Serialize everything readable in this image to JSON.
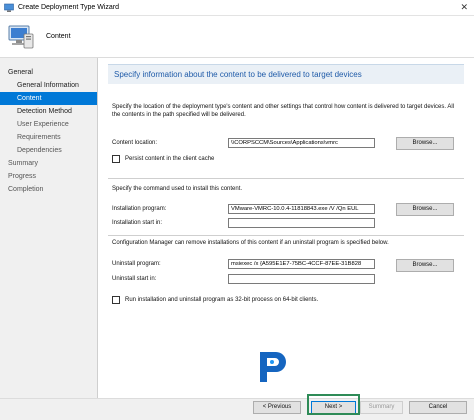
{
  "window": {
    "title": "Create Deployment Type Wizard",
    "close_glyph": "✕"
  },
  "header": {
    "page_heading": "Content"
  },
  "nav": {
    "items": [
      {
        "label": "General",
        "level": 0,
        "state": "dark"
      },
      {
        "label": "General Information",
        "level": 1,
        "state": "dark"
      },
      {
        "label": "Content",
        "level": 1,
        "state": "active"
      },
      {
        "label": "Detection Method",
        "level": 1,
        "state": "dark"
      },
      {
        "label": "User Experience",
        "level": 1,
        "state": "normal"
      },
      {
        "label": "Requirements",
        "level": 1,
        "state": "normal"
      },
      {
        "label": "Dependencies",
        "level": 1,
        "state": "normal"
      },
      {
        "label": "Summary",
        "level": 0,
        "state": "normal"
      },
      {
        "label": "Progress",
        "level": 0,
        "state": "normal"
      },
      {
        "label": "Completion",
        "level": 0,
        "state": "normal"
      }
    ]
  },
  "main": {
    "heading": "Specify information about the content to be delivered to target devices",
    "description": "Specify the location of the deployment type's content and other settings that control how content is delivered to target devices. All the contents in the path specified will be delivered.",
    "content_location": {
      "label": "Content location:",
      "value": "\\\\CORPSCCM\\Sources\\Applications\\vmrc",
      "browse": "Browse..."
    },
    "persist_cache": {
      "label": "Persist content in the client cache",
      "checked": false
    },
    "install_intro": "Specify the command used to install this content.",
    "installation_program": {
      "label": "Installation program:",
      "value": "VMware-VMRC-10.0.4-11818843.exe /V /Qn EUL",
      "browse": "Browse..."
    },
    "installation_start_in": {
      "label": "Installation start in:",
      "value": ""
    },
    "uninstall_intro": "Configuration Manager can remove installations of this content if an uninstall program is specified below.",
    "uninstall_program": {
      "label": "Uninstall program:",
      "value": "msiexec /x {A595E1E7-75BC-4CCF-87EE-31B828",
      "browse": "Browse..."
    },
    "uninstall_start_in": {
      "label": "Uninstall start in:",
      "value": ""
    },
    "run_32bit": {
      "label": "Run installation and uninstall program as 32-bit process on 64-bit clients.",
      "checked": false
    }
  },
  "footer": {
    "previous": "< Previous",
    "next": "Next >",
    "summary": "Summary",
    "cancel": "Cancel"
  },
  "colors": {
    "accent": "#0078d7",
    "heading": "#1e5aa8",
    "highlight": "#2e8b57"
  }
}
